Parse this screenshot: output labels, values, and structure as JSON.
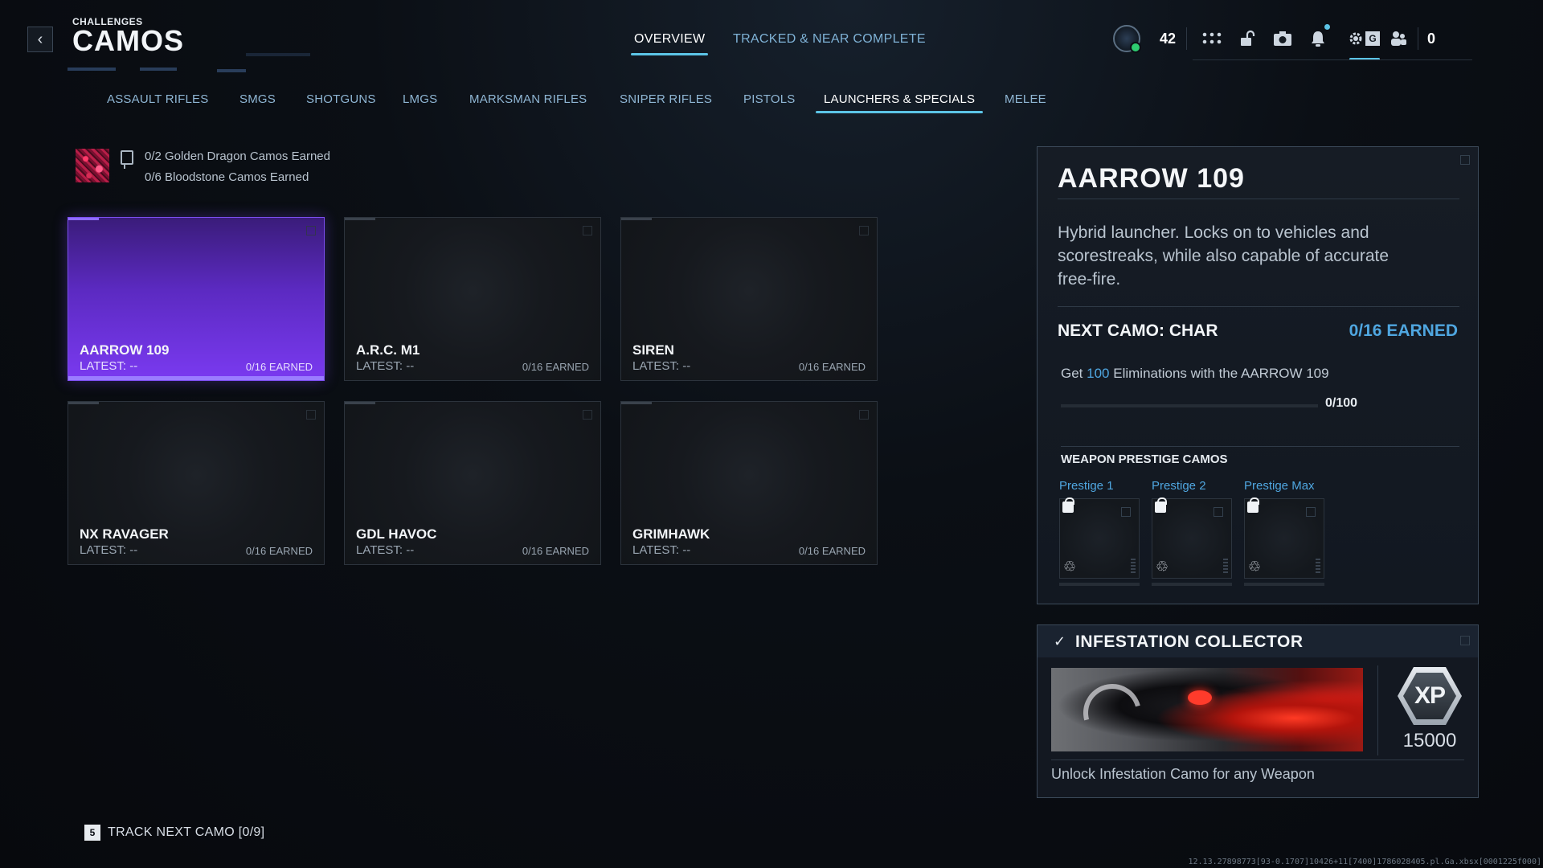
{
  "header": {
    "breadcrumb": "CHALLENGES",
    "title": "CAMOS",
    "tabs": [
      {
        "label": "OVERVIEW",
        "active": true
      },
      {
        "label": "TRACKED & NEAR COMPLETE",
        "active": false
      }
    ],
    "status": {
      "level": "42",
      "currency": "0",
      "settings_badge_letter": "G",
      "accent_color": "#5cc4e6",
      "icons": [
        "level-badge-icon",
        "grid-menu-icon",
        "unlock-icon",
        "camera-icon",
        "bell-icon",
        "settings-icon",
        "social-icon"
      ]
    }
  },
  "categories": [
    {
      "label": "ASSAULT RIFLES",
      "active": false
    },
    {
      "label": "SMGS",
      "active": false
    },
    {
      "label": "SHOTGUNS",
      "active": false
    },
    {
      "label": "LMGS",
      "active": false
    },
    {
      "label": "MARKSMAN RIFLES",
      "active": false
    },
    {
      "label": "SNIPER RIFLES",
      "active": false
    },
    {
      "label": "PISTOLS",
      "active": false
    },
    {
      "label": "LAUNCHERS & SPECIALS",
      "active": true
    },
    {
      "label": "MELEE",
      "active": false
    }
  ],
  "mastery": {
    "golden_dragon": "0/2 Golden Dragon Camos Earned",
    "bloodstone": "0/6 Bloodstone Camos Earned"
  },
  "weapons": [
    {
      "name": "AARROW 109",
      "latest": "LATEST: --",
      "earned": "0/16 EARNED",
      "selected": true
    },
    {
      "name": "A.R.C. M1",
      "latest": "LATEST: --",
      "earned": "0/16 EARNED",
      "selected": false
    },
    {
      "name": "SIREN",
      "latest": "LATEST: --",
      "earned": "0/16 EARNED",
      "selected": false
    },
    {
      "name": "NX RAVAGER",
      "latest": "LATEST: --",
      "earned": "0/16 EARNED",
      "selected": false
    },
    {
      "name": "GDL HAVOC",
      "latest": "LATEST: --",
      "earned": "0/16 EARNED",
      "selected": false
    },
    {
      "name": "GRIMHAWK",
      "latest": "LATEST: --",
      "earned": "0/16 EARNED",
      "selected": false
    }
  ],
  "detail": {
    "title": "AARROW 109",
    "description": "Hybrid launcher. Locks on to vehicles and scorestreaks, while also capable of accurate free-fire.",
    "next_camo_label": "NEXT CAMO: CHAR",
    "next_camo_earned": "0/16 EARNED",
    "challenge_prefix": "Get",
    "challenge_count": "100",
    "challenge_suffix": "Eliminations with the AARROW 109",
    "progress_text": "0/100",
    "progress_fraction": 0,
    "prestige_header": "WEAPON PRESTIGE CAMOS",
    "prestige": [
      {
        "label": "Prestige 1",
        "locked": true
      },
      {
        "label": "Prestige 2",
        "locked": true
      },
      {
        "label": "Prestige Max",
        "locked": true
      }
    ],
    "highlight_color": "#4fa6e0"
  },
  "reward": {
    "title": "INFESTATION COLLECTOR",
    "xp_label": "XP",
    "xp_amount": "15000",
    "description": "Unlock Infestation Camo for any Weapon"
  },
  "footer": {
    "track_key": "5",
    "track_label": "TRACK NEXT CAMO [0/9]",
    "build": "12.13.27898773[93-0.1707]10426+11[7400]1786028405.pl.Ga.xbsx[0001225f000]"
  }
}
